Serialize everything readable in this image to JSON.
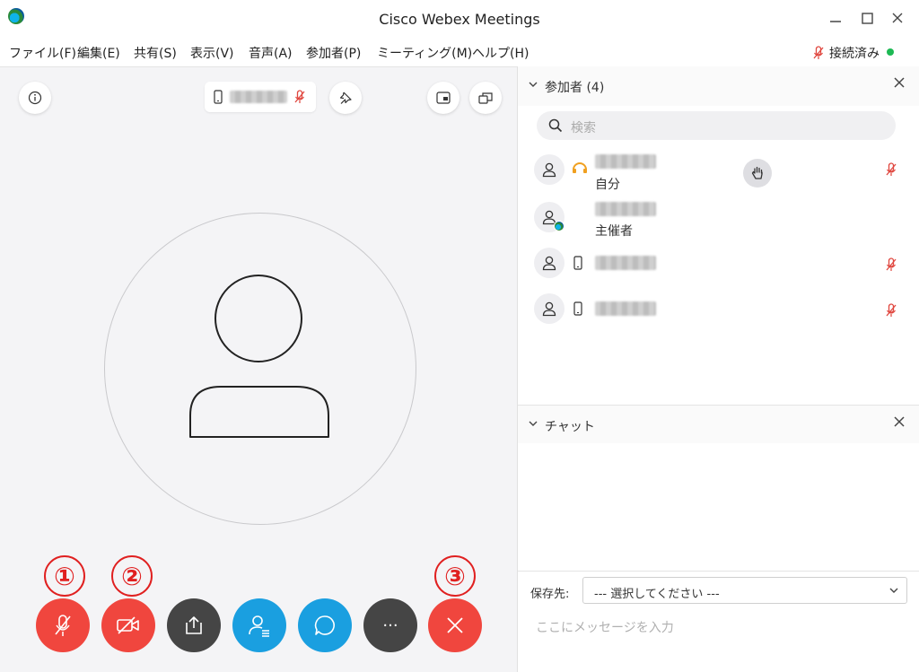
{
  "window": {
    "title": "Cisco Webex Meetings"
  },
  "menu": [
    {
      "label": "ファイル(F)"
    },
    {
      "label": "編集(E)"
    },
    {
      "label": "共有(S)"
    },
    {
      "label": "表示(V)"
    },
    {
      "label": "音声(A)"
    },
    {
      "label": "参加者(P)"
    },
    {
      "label": "ミーティング(M)"
    },
    {
      "label": "ヘルプ(H)"
    }
  ],
  "connection": {
    "label": "接続済み",
    "dot_color": "#1db954"
  },
  "annotations": {
    "one": "①",
    "two": "②",
    "three": "③"
  },
  "controls": {
    "mute_color": "#f0463e",
    "video_color": "#f0463e",
    "share_color": "#454545",
    "participants_color": "#1a9fe0",
    "chat_color": "#1a9fe0",
    "more_color": "#454545",
    "more_label": "···",
    "leave_color": "#f0463e"
  },
  "participants_panel": {
    "title": "参加者 (4)",
    "search_placeholder": "検索",
    "rows": [
      {
        "role": "自分",
        "muted": true
      },
      {
        "role": "主催者",
        "muted": false
      },
      {
        "role": "",
        "muted": true
      },
      {
        "role": "",
        "muted": true
      }
    ]
  },
  "chat_panel": {
    "title": "チャット",
    "save_label": "保存先:",
    "select_value": "--- 選択してください ---",
    "input_placeholder": "ここにメッセージを入力"
  },
  "colors": {
    "muted_red": "#e0463e",
    "accent_blue": "#1a9fe0"
  }
}
